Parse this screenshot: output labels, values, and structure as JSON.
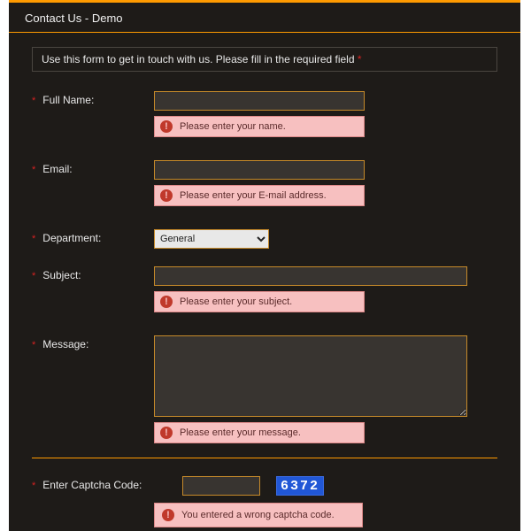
{
  "header": {
    "title": "Contact Us - Demo"
  },
  "intro": {
    "text": "Use this form to get in touch with us. Please fill in the required field ",
    "req_marker": "*"
  },
  "fields": {
    "fullname": {
      "label": "Full Name:",
      "value": "",
      "error": "Please enter your name."
    },
    "email": {
      "label": "Email:",
      "value": "",
      "error": "Please enter your E-mail address."
    },
    "department": {
      "label": "Department:",
      "selected": "General"
    },
    "subject": {
      "label": "Subject:",
      "value": "",
      "error": "Please enter your subject."
    },
    "message": {
      "label": "Message:",
      "value": "",
      "error": "Please enter your message."
    },
    "captcha": {
      "label": "Enter Captcha Code:",
      "value": "",
      "code": "6372",
      "error": "You entered a wrong captcha code."
    }
  },
  "icons": {
    "error_glyph": "!"
  }
}
